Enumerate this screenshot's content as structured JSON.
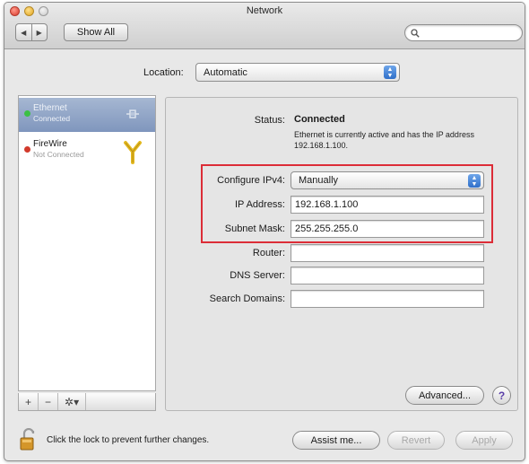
{
  "window": {
    "title": "Network"
  },
  "toolbar": {
    "back_glyph": "◀",
    "forward_glyph": "▶",
    "show_all_label": "Show All",
    "search_value": "",
    "search_icon": "search-icon"
  },
  "location": {
    "label": "Location:",
    "value": "Automatic"
  },
  "sidebar": {
    "items": [
      {
        "name": "Ethernet",
        "status": "Connected",
        "status_color": "#3cc045",
        "selected": true,
        "icon": "ethernet-icon"
      },
      {
        "name": "FireWire",
        "status": "Not Connected",
        "status_color": "#d23a2c",
        "selected": false,
        "icon": "firewire-icon"
      }
    ],
    "tools": {
      "add": "+",
      "remove": "−",
      "action": "✲▾"
    }
  },
  "detail": {
    "status_label": "Status:",
    "status_value": "Connected",
    "status_desc": "Ethernet is currently active and has the IP address 192.168.1.100.",
    "configure_label": "Configure IPv4:",
    "configure_value": "Manually",
    "ip_label": "IP Address:",
    "ip_value": "192.168.1.100",
    "subnet_label": "Subnet Mask:",
    "subnet_value": "255.255.255.0",
    "router_label": "Router:",
    "router_value": "",
    "dns_label": "DNS Server:",
    "dns_value": "",
    "search_domains_label": "Search Domains:",
    "search_domains_value": "",
    "highlight_color": "#dc2d37"
  },
  "buttons": {
    "advanced": "Advanced...",
    "help": "?",
    "assist": "Assist me...",
    "revert": "Revert",
    "apply": "Apply"
  },
  "footer": {
    "lock_text": "Click the lock to prevent further changes."
  }
}
